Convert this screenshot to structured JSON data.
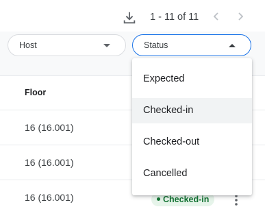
{
  "toolbar": {
    "download_icon": "download-icon",
    "pagination_text": "1 - 11 of 11",
    "prev_icon": "chevron-left-icon",
    "next_icon": "chevron-right-icon"
  },
  "filters": {
    "host": {
      "label": "Host",
      "icon": "arrow-drop-down-icon"
    },
    "status": {
      "label": "Status",
      "icon": "arrow-drop-up-icon",
      "open": true
    }
  },
  "table": {
    "columns": [
      "Floor"
    ],
    "rows": [
      {
        "floor": "16 (16.001)"
      },
      {
        "floor": "16 (16.001)"
      },
      {
        "floor": "16 (16.001)",
        "status": "Checked-in"
      }
    ]
  },
  "status_menu": {
    "options": [
      "Expected",
      "Checked-in",
      "Checked-out",
      "Cancelled"
    ],
    "highlighted": "Checked-in"
  },
  "colors": {
    "accent": "#1a73e8",
    "checked_in_text": "#137333",
    "checked_in_bg": "#e6f4ea"
  }
}
